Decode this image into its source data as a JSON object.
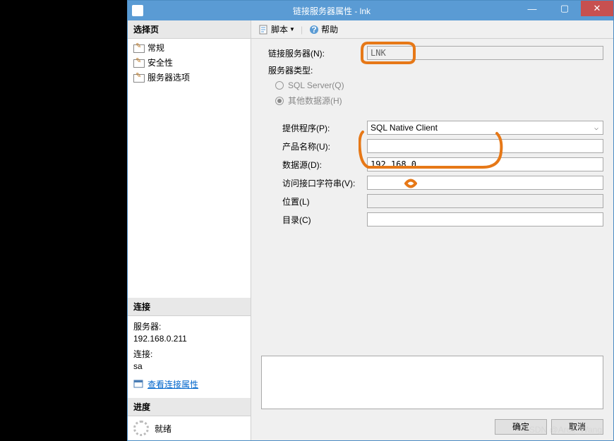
{
  "window": {
    "title": "链接服务器属性 - lnk"
  },
  "left": {
    "select_page_header": "选择页",
    "nav": [
      {
        "label": "常规"
      },
      {
        "label": "安全性"
      },
      {
        "label": "服务器选项"
      }
    ],
    "connection_header": "连接",
    "server_label": "服务器:",
    "server_value": "192.168.0.211",
    "conn_label": "连接:",
    "conn_value": "sa",
    "view_props": "查看连接属性",
    "progress_header": "进度",
    "progress_status": "就绪"
  },
  "toolbar": {
    "script": "脚本",
    "help": "帮助"
  },
  "form": {
    "linked_server_label": "链接服务器(N):",
    "linked_server_value": "LNK",
    "server_type_label": "服务器类型:",
    "radio_sqlserver": "SQL Server(Q)",
    "radio_other": "其他数据源(H)",
    "provider_label": "提供程序(P):",
    "provider_value": "SQL Native Client",
    "product_label": "产品名称(U):",
    "product_value": "",
    "datasource_label": "数据源(D):",
    "datasource_value": "192.168.0.",
    "provstring_label": "访问接口字符串(V):",
    "provstring_value": "",
    "location_label": "位置(L)",
    "location_value": "",
    "catalog_label": "目录(C)",
    "catalog_value": ""
  },
  "buttons": {
    "ok": "确定",
    "cancel": "取消"
  },
  "watermark": "CSDN @Aros_Wang"
}
